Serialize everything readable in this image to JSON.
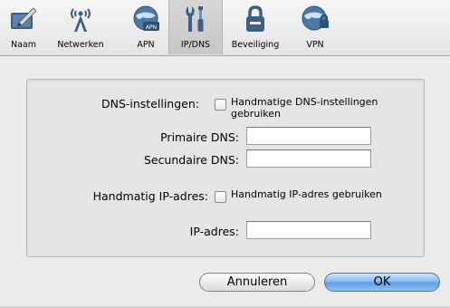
{
  "toolbar": {
    "items": [
      {
        "label": "Naam",
        "icon": "pen-card-icon"
      },
      {
        "label": "Netwerken",
        "icon": "antenna-icon"
      },
      {
        "label": "APN",
        "icon": "apn-globe-icon"
      },
      {
        "label": "IP/DNS",
        "icon": "tools-icon"
      },
      {
        "label": "Beveiliging",
        "icon": "lock-icon"
      },
      {
        "label": "VPN",
        "icon": "vpn-globe-icon"
      }
    ],
    "selected": "IP/DNS"
  },
  "dns": {
    "section_label": "DNS-instellingen:",
    "manual_checkbox_line1": "Handmatige DNS-instellingen",
    "manual_checkbox_line2": "gebruiken",
    "manual_checked": false,
    "primary_label": "Primaire DNS:",
    "primary_value": "",
    "secondary_label": "Secundaire DNS:",
    "secondary_value": ""
  },
  "ip": {
    "section_label": "Handmatig IP-adres:",
    "manual_checkbox_label": "Handmatig IP-adres gebruiken",
    "manual_checked": false,
    "address_label": "IP-adres:",
    "address_value": ""
  },
  "buttons": {
    "cancel_label": "Annuleren",
    "ok_label": "OK"
  },
  "colors": {
    "accent_button": "#6aa8e8",
    "window_bg": "#ececec"
  }
}
